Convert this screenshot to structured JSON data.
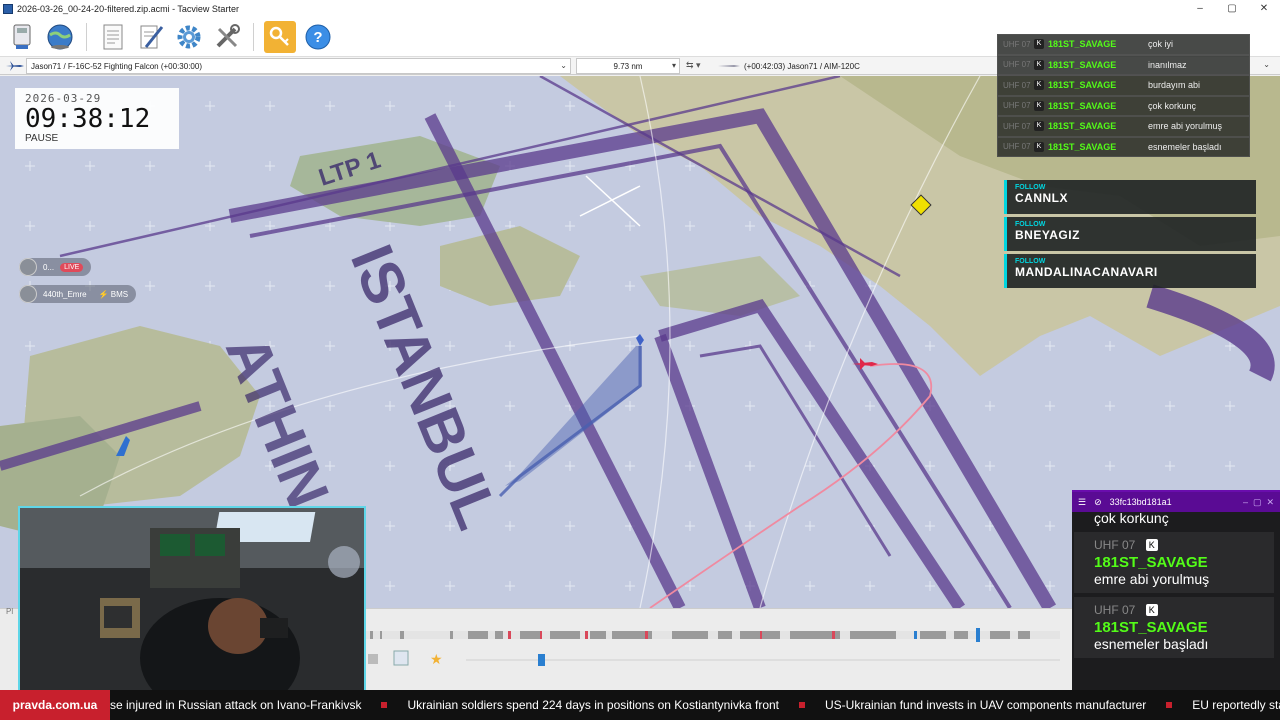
{
  "window": {
    "title": "2026-03-26_00-24-20-filtered.zip.acmi - Tacview Starter",
    "buttons": [
      "–",
      "▢",
      "✕"
    ]
  },
  "toolbar": {
    "items": [
      "usb-drive-icon",
      "globe-icon",
      "document-icon",
      "notepad-icon",
      "gear-icon",
      "tools-icon",
      "key-icon",
      "help-icon"
    ]
  },
  "selectors": {
    "primary_object": "Jason71 / F-16C-52 Fighting Falcon (+00:30:00)",
    "distance": "9.73 nm",
    "secondary_object": "(+00:42:03) Jason71 / AIM-120C"
  },
  "time_overlay": {
    "date": "2026-03-29",
    "clock": "09:38:12",
    "state": "PAUSE"
  },
  "map_labels": {
    "ltp": "LTP 1",
    "istanbul": "ISTANBUL",
    "athina": "ATHIN"
  },
  "live_users": [
    {
      "name": "0...",
      "badge": "LIVE"
    },
    {
      "name": "440th_Emre",
      "badge": "BMS"
    }
  ],
  "chat_list": [
    {
      "channel": "UHF 07",
      "badge": "K",
      "user": "181ST_SAVAGE",
      "message": "çok iyi"
    },
    {
      "channel": "UHF 07",
      "badge": "K",
      "user": "181ST_SAVAGE",
      "message": "inanılmaz"
    },
    {
      "channel": "UHF 07",
      "badge": "K",
      "user": "181ST_SAVAGE",
      "message": "burdayım abi"
    },
    {
      "channel": "UHF 07",
      "badge": "K",
      "user": "181ST_SAVAGE",
      "message": "çok korkunç"
    },
    {
      "channel": "UHF 07",
      "badge": "K",
      "user": "181ST_SAVAGE",
      "message": "emre abi yorulmuş"
    },
    {
      "channel": "UHF 07",
      "badge": "K",
      "user": "181ST_SAVAGE",
      "message": "esnemeler başladı"
    }
  ],
  "follows": [
    {
      "label": "FOLLOW",
      "name": "CANNLX"
    },
    {
      "label": "FOLLOW",
      "name": "BNEYAGIZ"
    },
    {
      "label": "FOLLOW",
      "name": "MANDALINACANAVARI"
    }
  ],
  "chat_popout": {
    "title": "33fc13bd181a1",
    "prev_message": "çok korkunç",
    "entries": [
      {
        "channel": "UHF 07",
        "badge": "K",
        "user": "181ST_SAVAGE",
        "message": "emre abi yorulmuş"
      },
      {
        "channel": "UHF 07",
        "badge": "K",
        "user": "181ST_SAVAGE",
        "message": "esnemeler başladı"
      }
    ]
  },
  "timeline": {
    "left_label": "Pl"
  },
  "ticker": {
    "brand": "pravda.com.ua",
    "items": [
      "se injured in Russian attack on Ivano-Frankivsk",
      "Ukrainian soldiers spend 224 days in positions on Kostiantynivka front",
      "US-Ukrainian fund invests in UAV components manufacturer",
      "EU reportedly stalls Hu"
    ]
  },
  "colors": {
    "kick_green": "#53fc18",
    "follow_accent": "#00d6e0",
    "chat_header": "#5a0b94",
    "ticker_red": "#c8202d",
    "airspace_purple": "#5a3a8c"
  }
}
